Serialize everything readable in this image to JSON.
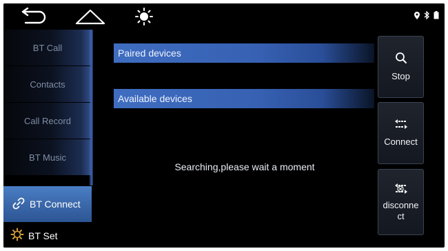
{
  "sidebar": {
    "items": [
      {
        "label": "BT Call"
      },
      {
        "label": "Contacts"
      },
      {
        "label": "Call Record"
      },
      {
        "label": "BT Music"
      },
      {
        "label": "BT Connect"
      },
      {
        "label": "BT Set"
      }
    ],
    "active_index": 4
  },
  "sections": {
    "paired": "Paired devices",
    "available": "Available devices"
  },
  "status_message": "Searching,please wait a moment",
  "actions": {
    "stop": "Stop",
    "connect": "Connect",
    "disconnect_line1": "disconne",
    "disconnect_line2": "ct"
  },
  "icons": {
    "nav": [
      "back-icon",
      "home-icon",
      "brightness-icon"
    ],
    "status": [
      "location-icon",
      "bluetooth-icon",
      "battery-icon"
    ]
  },
  "colors": {
    "accent": "#3a66a8",
    "section_bar": "#3761b3",
    "background": "#000000"
  }
}
